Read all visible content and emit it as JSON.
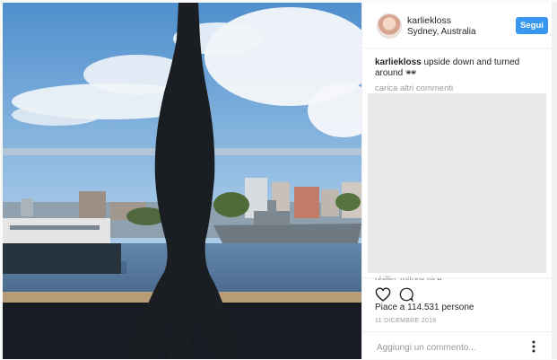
{
  "post": {
    "username": "karliekloss",
    "location": "Sydney, Australia",
    "follow_label": "Segui",
    "caption_user": "karliekloss",
    "caption_text": " upside down and turned around 🕶",
    "load_more_label": "carica altri commenti",
    "comment_fragment": "phillip_ruttons nice",
    "likes": "Piace a 114.531 persone",
    "date": "11 DICEMBRE 2016",
    "comment_placeholder": "Aggiungi un commento..."
  },
  "icons": {
    "like": "heart-icon",
    "comment": "speech-bubble-icon",
    "more": "more-options-icon"
  },
  "colors": {
    "follow": "#3897f0",
    "sky": "#9ec4e6",
    "water": "#5a7fa5"
  }
}
